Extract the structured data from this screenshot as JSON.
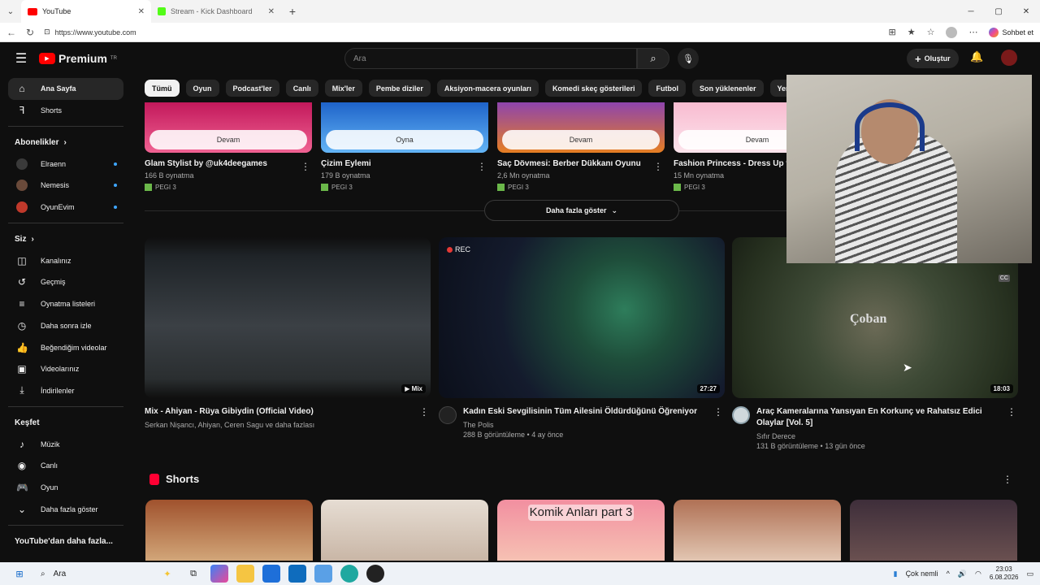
{
  "browser": {
    "tabs": [
      {
        "title": "YouTube",
        "active": true
      },
      {
        "title": "Stream - Kick Dashboard",
        "active": false
      }
    ],
    "new_tab": "+",
    "url": "https://www.youtube.com",
    "copilot_label": "Sohbet et",
    "window_controls": {
      "minimize": "─",
      "maximize": "▢",
      "close": "✕"
    }
  },
  "youtube": {
    "logo_text": "Premium",
    "logo_region": "TR",
    "search_placeholder": "Ara",
    "create_label": "Oluştur",
    "sidebar": {
      "main": [
        {
          "label": "Ana Sayfa",
          "icon": "home-icon",
          "active": true
        },
        {
          "label": "Shorts",
          "icon": "shorts-icon",
          "active": false
        }
      ],
      "subscriptions_header": "Abonelikler",
      "subscriptions": [
        {
          "label": "Elraenn",
          "avatar_color": "#3a3a3a"
        },
        {
          "label": "Nemesis",
          "avatar_color": "#6a4a3a"
        },
        {
          "label": "OyunEvim",
          "avatar_color": "#c0392b"
        }
      ],
      "you_header": "Siz",
      "you": [
        {
          "label": "Kanalınız",
          "icon": "channel-icon"
        },
        {
          "label": "Geçmiş",
          "icon": "history-icon"
        },
        {
          "label": "Oynatma listeleri",
          "icon": "playlists-icon"
        },
        {
          "label": "Daha sonra izle",
          "icon": "watch-later-icon"
        },
        {
          "label": "Beğendiğim videolar",
          "icon": "like-icon"
        },
        {
          "label": "Videolarınız",
          "icon": "your-videos-icon"
        },
        {
          "label": "İndirilenler",
          "icon": "download-icon"
        }
      ],
      "explore_header": "Keşfet",
      "explore": [
        {
          "label": "Müzik",
          "icon": "music-icon"
        },
        {
          "label": "Canlı",
          "icon": "live-icon"
        },
        {
          "label": "Oyun",
          "icon": "gaming-icon"
        },
        {
          "label": "Daha fazla göster",
          "icon": "chevron-down-icon"
        }
      ],
      "more_from_youtube": "YouTube'dan daha fazla..."
    },
    "chips": [
      "Tümü",
      "Oyun",
      "Podcast'ler",
      "Canlı",
      "Mix'ler",
      "Pembe diziler",
      "Aksiyon-macera oyunları",
      "Komedi skeç gösterileri",
      "Futbol",
      "Son yüklenenler",
      "Yeni önerile"
    ],
    "games": [
      {
        "button": "Devam",
        "title": "Glam Stylist by @uk4deegames",
        "plays": "166 B oynatma",
        "rating": "PEGI 3",
        "color": "#c2185b"
      },
      {
        "button": "Oyna",
        "title": "Çizim Eylemi",
        "plays": "179 B oynatma",
        "rating": "PEGI 3",
        "color": "#1e63c9"
      },
      {
        "button": "Devam",
        "title": "Saç Dövmesi: Berber Dükkanı Oyunu",
        "plays": "2,6 Mn oynatma",
        "rating": "PEGI 3",
        "color": "#8e44ad"
      },
      {
        "button": "Devam",
        "title": "Fashion Princess - Dress Up t",
        "plays": "15 Mn oynatma",
        "rating": "PEGI 3",
        "color": "#f4a6c8"
      }
    ],
    "show_more": "Daha fazla göster",
    "videos": [
      {
        "title": "Mix - Ahiyan - Rüya Gibiydin (Official Video)",
        "channel": "Serkan Nişancı, Ahiyan, Ceren Sagu ve daha fazlası",
        "stats": "",
        "badge": "Mix",
        "overlay": ""
      },
      {
        "title": "Kadın Eski Sevgilisinin Tüm Ailesini Öldürdüğünü Öğreniyor",
        "channel": "The Polis",
        "stats": "288 B görüntüleme • 4 ay önce",
        "badge": "27:27",
        "overlay": "REC"
      },
      {
        "title": "Araç Kameralarına Yansıyan En Korkunç ve Rahatsız Edici Olaylar [Vol. 5]",
        "channel": "Sıfır Derece",
        "stats": "131 B görüntüleme • 13 gün önce",
        "badge": "18:03",
        "overlay": "Çoban"
      }
    ],
    "shorts_header": "Shorts",
    "shorts": [
      {
        "caption": "",
        "color": "#8a5a3a"
      },
      {
        "caption": "",
        "color": "#d8c8b8"
      },
      {
        "caption": "Komik Anları part 3",
        "color": "#f28fa0"
      },
      {
        "caption": "",
        "color": "#c98a6a"
      },
      {
        "caption": "",
        "color": "#4a3b3b"
      }
    ]
  },
  "taskbar": {
    "search": "Ara",
    "weather": "Çok nemli",
    "time": "23:03",
    "date": "6.08.2026"
  }
}
